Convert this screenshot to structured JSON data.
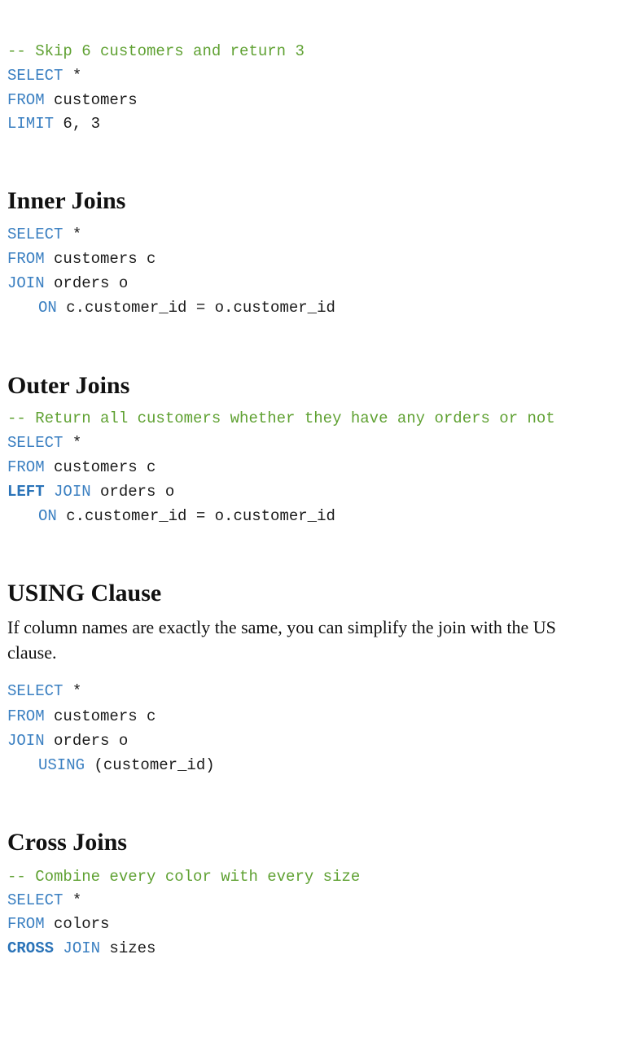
{
  "block1": {
    "comment": "-- Skip 6 customers and return 3",
    "select_kw": "SELECT",
    "select_rest": " *",
    "from_kw": "FROM",
    "from_rest": " customers",
    "limit_kw": "LIMIT",
    "limit_rest": " 6, 3"
  },
  "inner": {
    "title": "Inner Joins",
    "select_kw": "SELECT",
    "select_rest": " *",
    "from_kw": "FROM",
    "from_rest": " customers c",
    "join_kw": "JOIN",
    "join_rest": " orders o",
    "on_kw": "ON",
    "on_rest": " c.customer_id = o.customer_id"
  },
  "outer": {
    "title": "Outer Joins",
    "comment": "-- Return all customers whether they have any orders or not",
    "select_kw": "SELECT",
    "select_rest": " *",
    "from_kw": "FROM",
    "from_rest": " customers c",
    "left_kw": "LEFT",
    "join_kw": " JOIN",
    "join_rest": " orders o",
    "on_kw": "ON",
    "on_rest": " c.customer_id = o.customer_id"
  },
  "using": {
    "title": "USING Clause",
    "para_line1": "If column names are exactly the same, you can simplify the join with the US",
    "para_line2": "clause.",
    "select_kw": "SELECT",
    "select_rest": " *",
    "from_kw": "FROM",
    "from_rest": " customers c",
    "join_kw": "JOIN",
    "join_rest": " orders o",
    "using_kw": "USING",
    "using_rest": " (customer_id)"
  },
  "cross": {
    "title": "Cross Joins",
    "comment": "-- Combine every color with every size",
    "select_kw": "SELECT",
    "select_rest": " *",
    "from_kw": "FROM",
    "from_rest": " colors",
    "cross_kw": "CROSS",
    "join_kw": " JOIN",
    "join_rest": " sizes"
  },
  "colors": {
    "keyword": "#3a7fc1",
    "comment": "#5fa132",
    "text": "#1a1a1a"
  }
}
